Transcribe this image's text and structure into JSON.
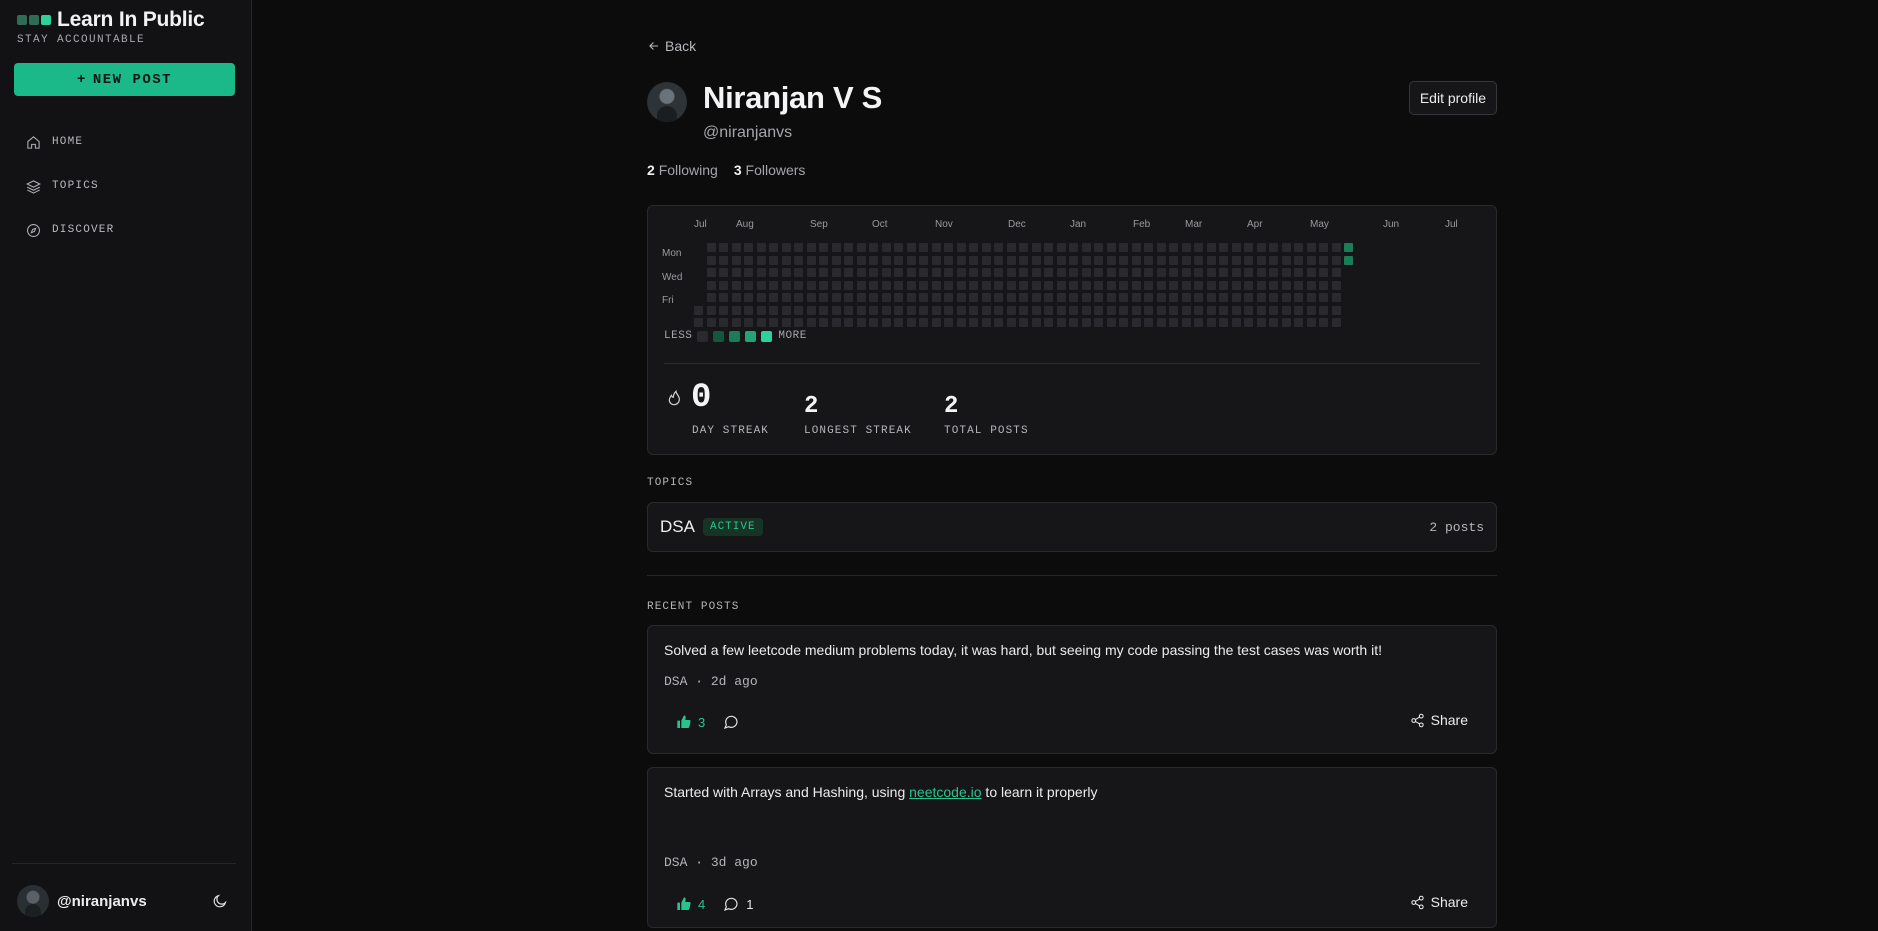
{
  "brand": {
    "title": "Learn In Public",
    "subtitle": "STAY ACCOUNTABLE",
    "dot_colors": [
      "#2f6b55",
      "#2f6b55",
      "#2fd19a"
    ]
  },
  "sidebar": {
    "new_post_label": "NEW POST",
    "items": [
      {
        "label": "HOME",
        "icon": "home-icon"
      },
      {
        "label": "TOPICS",
        "icon": "layers-icon"
      },
      {
        "label": "DISCOVER",
        "icon": "compass-icon"
      }
    ],
    "user_handle": "@niranjanvs"
  },
  "profile": {
    "back_label": "Back",
    "name": "Niranjan V S",
    "handle": "@niranjanvs",
    "edit_label": "Edit profile",
    "following_count": "2",
    "following_label": "Following",
    "followers_count": "3",
    "followers_label": "Followers"
  },
  "heatmap": {
    "months": [
      "Jul",
      "Aug",
      "Sep",
      "Oct",
      "Nov",
      "Dec",
      "Jan",
      "Feb",
      "Mar",
      "Apr",
      "May",
      "Jun",
      "Jul"
    ],
    "day_labels": [
      "Mon",
      "Wed",
      "Fri"
    ],
    "legend_less": "LESS",
    "legend_more": "MORE",
    "legend_colors": [
      "#2a2a2e",
      "#15563f",
      "#1b7c58",
      "#22a574",
      "#2fd19a"
    ],
    "empty_color": "#2a2a2e",
    "active_color": "#1b7c58"
  },
  "stats": {
    "day_streak": "0",
    "day_streak_label": "DAY STREAK",
    "longest_streak": "2",
    "longest_streak_label": "LONGEST STREAK",
    "total_posts": "2",
    "total_posts_label": "TOTAL POSTS"
  },
  "topics": {
    "section_label": "TOPICS",
    "items": [
      {
        "name": "DSA",
        "badge": "ACTIVE",
        "count": "2 posts"
      }
    ]
  },
  "recent_posts": {
    "section_label": "RECENT POSTS",
    "items": [
      {
        "text": "Solved a few leetcode medium problems today, it was hard, but seeing my code passing the test cases was worth it!",
        "topic": "DSA",
        "time": "2d ago",
        "likes": "3",
        "comments": "",
        "share_label": "Share"
      },
      {
        "text_before": "Started with Arrays and Hashing, using ",
        "link_text": "neetcode.io",
        "text_after": " to learn it properly",
        "topic": "DSA",
        "time": "3d ago",
        "likes": "4",
        "comments": "1",
        "share_label": "Share"
      }
    ]
  },
  "meta_separator": "·"
}
